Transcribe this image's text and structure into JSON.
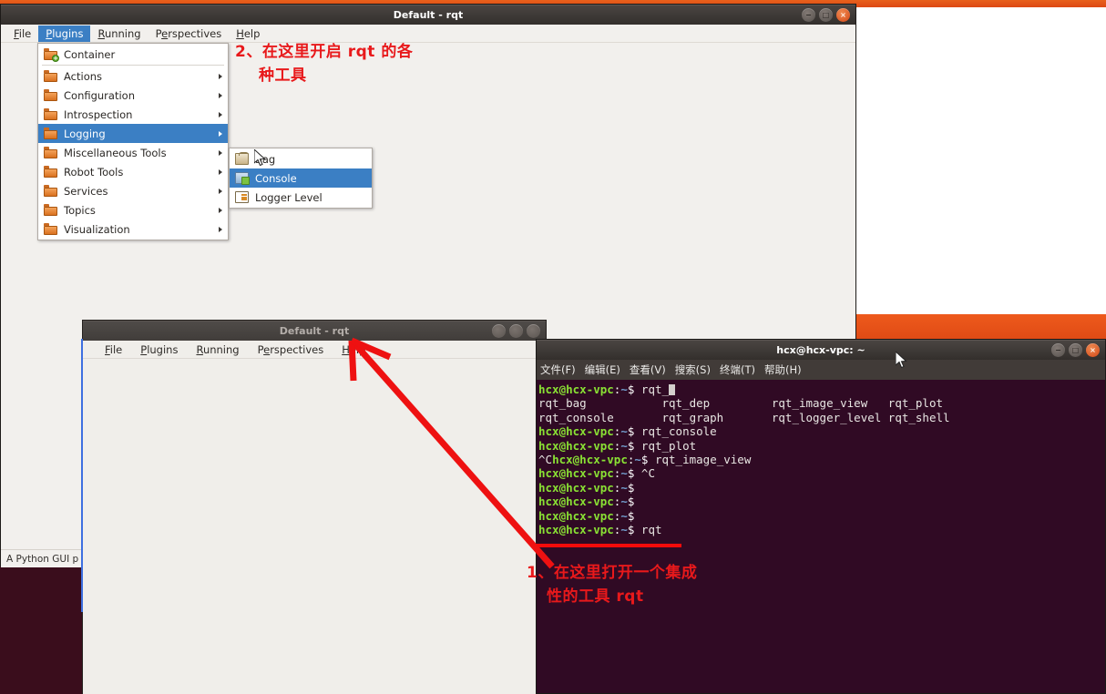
{
  "desktop": {
    "accent_orange": "#dd4814",
    "terminal_bg": "#300a24",
    "annotation_color": "#e8191b"
  },
  "rqt_main": {
    "title": "Default - rqt",
    "menubar": [
      {
        "label": "File",
        "accel": "F",
        "active": false
      },
      {
        "label": "Plugins",
        "accel": "P",
        "active": true
      },
      {
        "label": "Running",
        "accel": "R",
        "active": false
      },
      {
        "label": "Perspectives",
        "accel": "e",
        "active": false
      },
      {
        "label": "Help",
        "accel": "H",
        "active": false
      }
    ],
    "plugins_menu": [
      {
        "label": "Container",
        "icon": "folder-plus-icon",
        "submenu": false,
        "selected": false,
        "separator_after": true
      },
      {
        "label": "Actions",
        "icon": "folder-icon",
        "submenu": true,
        "selected": false
      },
      {
        "label": "Configuration",
        "icon": "folder-icon",
        "submenu": true,
        "selected": false
      },
      {
        "label": "Introspection",
        "icon": "folder-icon",
        "submenu": true,
        "selected": false
      },
      {
        "label": "Logging",
        "icon": "folder-icon",
        "submenu": true,
        "selected": true
      },
      {
        "label": "Miscellaneous Tools",
        "icon": "folder-icon",
        "submenu": true,
        "selected": false
      },
      {
        "label": "Robot Tools",
        "icon": "folder-icon",
        "submenu": true,
        "selected": false
      },
      {
        "label": "Services",
        "icon": "folder-icon",
        "submenu": true,
        "selected": false
      },
      {
        "label": "Topics",
        "icon": "folder-icon",
        "submenu": true,
        "selected": false
      },
      {
        "label": "Visualization",
        "icon": "folder-icon",
        "submenu": true,
        "selected": false
      }
    ],
    "logging_submenu": [
      {
        "label": "Bag",
        "icon": "bag-icon",
        "selected": false
      },
      {
        "label": "Console",
        "icon": "console-icon",
        "selected": true
      },
      {
        "label": "Logger Level",
        "icon": "logger-level-icon",
        "selected": false
      }
    ],
    "statusbar": "A Python GUI p",
    "window_buttons": {
      "minimize": "−",
      "maximize": "□",
      "close": "×"
    }
  },
  "rqt_second": {
    "title": "Default - rqt",
    "menubar": [
      {
        "label": "File",
        "accel": "F"
      },
      {
        "label": "Plugins",
        "accel": "P"
      },
      {
        "label": "Running",
        "accel": "R"
      },
      {
        "label": "Perspectives",
        "accel": "e"
      },
      {
        "label": "Help",
        "accel": "H"
      }
    ]
  },
  "terminal": {
    "title": "hcx@hcx-vpc: ~",
    "menubar": [
      "文件(F)",
      "编辑(E)",
      "查看(V)",
      "搜索(S)",
      "终端(T)",
      "帮助(H)"
    ],
    "prompt": {
      "user": "hcx@hcx-vpc",
      "colon": ":",
      "path": "~",
      "dollar": "$"
    },
    "lines": [
      {
        "type": "prompt",
        "command": "rqt_",
        "cursor": true
      },
      {
        "type": "output",
        "text": "rqt_bag           rqt_dep         rqt_image_view   rqt_plot"
      },
      {
        "type": "output",
        "text": "rqt_console       rqt_graph       rqt_logger_level rqt_shell"
      },
      {
        "type": "prompt",
        "command": "rqt_console"
      },
      {
        "type": "prompt",
        "command": "rqt_plot"
      },
      {
        "type": "prompt",
        "command": "rqt_image_view",
        "prefix": "^C"
      },
      {
        "type": "prompt",
        "command": "^C"
      },
      {
        "type": "prompt",
        "command": ""
      },
      {
        "type": "prompt",
        "command": ""
      },
      {
        "type": "prompt",
        "command": ""
      },
      {
        "type": "prompt",
        "command": "rqt"
      }
    ]
  },
  "annotations": {
    "one": {
      "line1": "1、在这里打开一个集成",
      "line2": "性的工具 rqt"
    },
    "two": {
      "line1": "2、在这里开启 rqt 的各",
      "line2": "种工具"
    }
  }
}
